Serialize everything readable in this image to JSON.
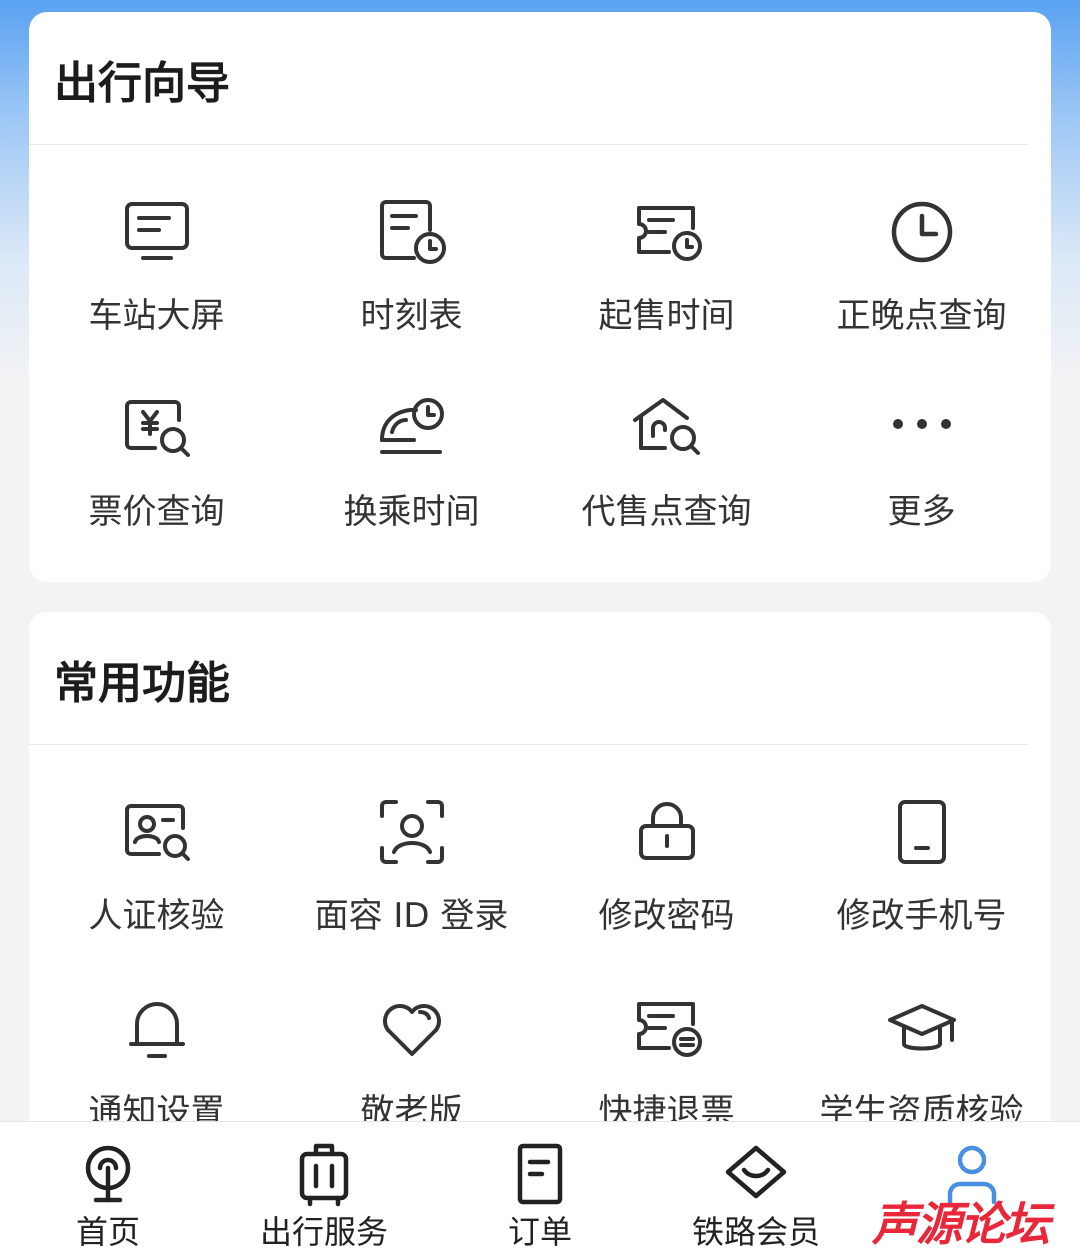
{
  "colors": {
    "accent": "#4a90e2",
    "text": "#333333",
    "title": "#1c1c1c",
    "watermark": "#e8283a"
  },
  "travel_guide": {
    "title": "出行向导",
    "items": [
      {
        "label": "车站大屏",
        "icon": "monitor-icon"
      },
      {
        "label": "时刻表",
        "icon": "timetable-icon"
      },
      {
        "label": "起售时间",
        "icon": "ticket-clock-icon"
      },
      {
        "label": "正晚点查询",
        "icon": "clock-icon"
      },
      {
        "label": "票价查询",
        "icon": "price-search-icon"
      },
      {
        "label": "换乘时间",
        "icon": "train-clock-icon"
      },
      {
        "label": "代售点查询",
        "icon": "outlet-search-icon"
      },
      {
        "label": "更多",
        "icon": "more-icon"
      }
    ]
  },
  "common_functions": {
    "title": "常用功能",
    "items": [
      {
        "label": "人证核验",
        "icon": "id-verify-icon"
      },
      {
        "label": "面容 ID 登录",
        "icon": "face-id-icon"
      },
      {
        "label": "修改密码",
        "icon": "lock-icon"
      },
      {
        "label": "修改手机号",
        "icon": "phone-icon"
      },
      {
        "label": "通知设置",
        "icon": "bell-icon"
      },
      {
        "label": "敬老版",
        "icon": "heart-icon"
      },
      {
        "label": "快捷退票",
        "icon": "ticket-refund-icon"
      },
      {
        "label": "学生资质核验",
        "icon": "graduation-cap-icon"
      }
    ]
  },
  "tabbar": {
    "items": [
      {
        "label": "首页",
        "icon": "railway-logo-icon",
        "active": false
      },
      {
        "label": "出行服务",
        "icon": "luggage-icon",
        "active": false
      },
      {
        "label": "订单",
        "icon": "order-icon",
        "active": false
      },
      {
        "label": "铁路会员",
        "icon": "diamond-icon",
        "active": false
      },
      {
        "label": "",
        "icon": "user-icon",
        "active": true
      }
    ]
  },
  "watermark": {
    "text": "声源论坛"
  }
}
